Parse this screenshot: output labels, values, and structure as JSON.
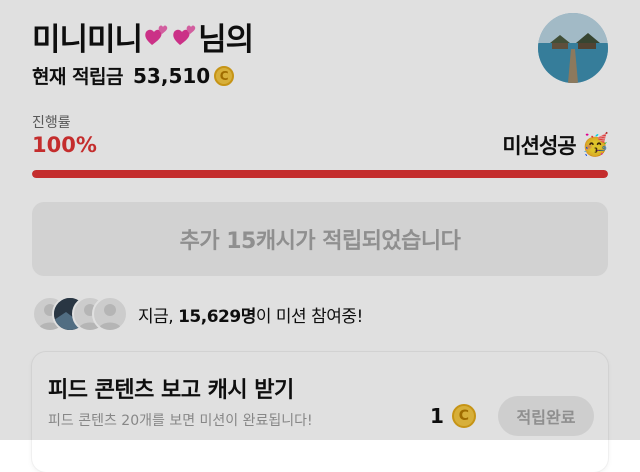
{
  "header": {
    "name_prefix": "미니미니",
    "name_suffix": "님의",
    "balance_label": "현재 적립금",
    "balance_amount": "53,510",
    "coin_symbol": "C"
  },
  "progress": {
    "label": "진행률",
    "percent_text": "100%",
    "value": 1.0,
    "status": "미션성공",
    "status_emoji": "🥳",
    "color": "#e03434"
  },
  "banner": {
    "text": "추가 15캐시가 적립되었습니다"
  },
  "participants": {
    "prefix": "지금, ",
    "count": "15,629명",
    "suffix": "이 미션 참여중!"
  },
  "mission_card": {
    "title": "피드 콘텐츠 보고 캐시 받기",
    "description": "피드 콘텐츠 20개를 보면 미션이 완료됩니다!",
    "reward": "1",
    "coin_symbol": "C",
    "button_label": "적립완료"
  }
}
